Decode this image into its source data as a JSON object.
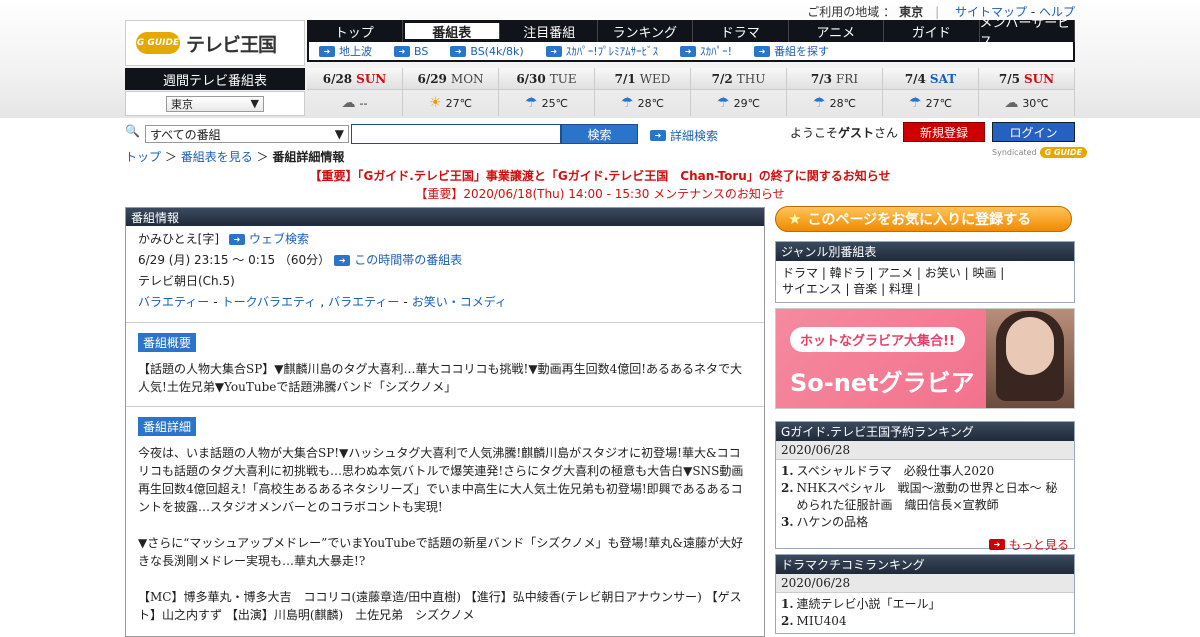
{
  "util": {
    "region_label": "ご利用の地域 ：",
    "region": "東京",
    "sitemap": "サイトマップ",
    "dash": "-",
    "help": "ヘルプ"
  },
  "logo": {
    "mark": "G GUIDE",
    "text": "テレビ王国"
  },
  "nav": [
    "トップ",
    "番組表",
    "注目番組",
    "ランキング",
    "ドラマ",
    "アニメ",
    "ガイド",
    "メンバーサービス"
  ],
  "subnav": [
    "地上波",
    "BS",
    "BS(4k/8k)",
    "ｽｶﾊﾟｰ!ﾌﾟﾚﾐｱﾑｻｰﾋﾞｽ",
    "ｽｶﾊﾟｰ!",
    "番組を探す"
  ],
  "week_title": "週間テレビ番組表",
  "area_select": "東京",
  "days": [
    {
      "date": "6/28",
      "wd": "SUN",
      "cls": "sun",
      "temp": "--",
      "w": "cl"
    },
    {
      "date": "6/29",
      "wd": "MON",
      "cls": "wd",
      "temp": "27℃",
      "w": "sn"
    },
    {
      "date": "6/30",
      "wd": "TUE",
      "cls": "wd",
      "temp": "25℃",
      "w": "um"
    },
    {
      "date": "7/1",
      "wd": "WED",
      "cls": "wd",
      "temp": "28℃",
      "w": "um"
    },
    {
      "date": "7/2",
      "wd": "THU",
      "cls": "wd",
      "temp": "29℃",
      "w": "um"
    },
    {
      "date": "7/3",
      "wd": "FRI",
      "cls": "wd",
      "temp": "28℃",
      "w": "um"
    },
    {
      "date": "7/4",
      "wd": "SAT",
      "cls": "sat",
      "temp": "27℃",
      "w": "um"
    },
    {
      "date": "7/5",
      "wd": "SUN",
      "cls": "sun",
      "temp": "30℃",
      "w": "cl"
    }
  ],
  "search": {
    "category": "すべての番組",
    "button": "検索",
    "advanced": "詳細検索"
  },
  "welcome": {
    "prefix": "ようこそ",
    "guest": "ゲスト",
    "suffix": "さん"
  },
  "register": "新規登録",
  "login": "ログイン",
  "syndicated": "Syndicated",
  "syndicated_logo": "G GUIDE",
  "breadcrumb": {
    "top": "トップ",
    "sep1": "＞",
    "schedule": "番組表を見る",
    "sep2": "＞",
    "current": "番組詳細情報"
  },
  "notice1": "【重要】「Gガイド.テレビ王国」事業譲渡と「Gガイド.テレビ王国　Chan-Toru」の終了に関するお知らせ",
  "notice2": "【重要】2020/06/18(Thu) 14:00 - 15:30 メンテナンスのお知らせ",
  "program": {
    "bar": "番組情報",
    "title": "かみひとえ[字]",
    "web_search": "ウェブ検索",
    "time": "6/29 (月) 23:15 ～ 0:15 （60分）",
    "time_link": "この時間帯の番組表",
    "channel": "テレビ朝日(Ch.5)",
    "genres": [
      "バラエティー",
      "-",
      "トークバラエティ",
      ",",
      "バラエティー",
      "-",
      "お笑い・コメディ"
    ],
    "summary_tag": "番組概要",
    "summary": "【話題の人物大集合SP】▼麒麟川島のタグ大喜利…華大ココリコも挑戦!▼動画再生回数4億回!あるあるネタで大人気!土佐兄弟▼YouTubeで話題沸騰バンド「シズクノメ」",
    "detail_tag": "番組詳細",
    "detail1": "今夜は、いま話題の人物が大集合SP!▼ハッシュタグ大喜利で人気沸騰!麒麟川島がスタジオに初登場!華大&ココリコも話題のタグ大喜利に初挑戦も…思わぬ本気バトルで爆笑連発!さらにタグ大喜利の極意も大告白▼SNS動画再生回数4億回超え!「高校生あるあるネタシリーズ」でいま中高生に大人気土佐兄弟も初登場!即興であるあるコントを披露…スタジオメンバーとのコラボコントも実現!",
    "detail2": "▼さらに“マッシュアップメドレー”でいまYouTubeで話題の新星バンド「シズクノメ」も登場!華丸&遠藤が大好きな長渕剛メドレー実現も…華丸大暴走!?",
    "detail3": "【MC】博多華丸・博多大吉　ココリコ(遠藤章造/田中直樹) 【進行】弘中綾香(テレビ朝日アナウンサー) 【ゲスト】山之内すず 【出演】川島明(麒麟)　土佐兄弟　シズクノメ"
  },
  "side": {
    "fav": "このページをお気に入りに登録する",
    "genre_head": "ジャンル別番組表",
    "genre_line1": "ドラマ | 韓ドラ | アニメ | お笑い | 映画 |",
    "genre_line2": "サイエンス | 音楽 | 料理 |",
    "banner_pill": "ホットなグラビア大集合!!",
    "banner_big": "So-netグラビア",
    "rank1_head": "Gガイド.テレビ王国予約ランキング",
    "rank1_date": "2020/06/28",
    "rank1": [
      "スペシャルドラマ　必殺仕事人2020",
      "NHKスペシャル　戦国〜激動の世界と日本〜 秘められた征服計画　織田信長×宣教師",
      "ハケンの品格"
    ],
    "more": "もっと見る",
    "rank2_head": "ドラマクチコミランキング",
    "rank2_date": "2020/06/28",
    "rank2": [
      "連続テレビ小説「エール」",
      "MIU404"
    ]
  }
}
